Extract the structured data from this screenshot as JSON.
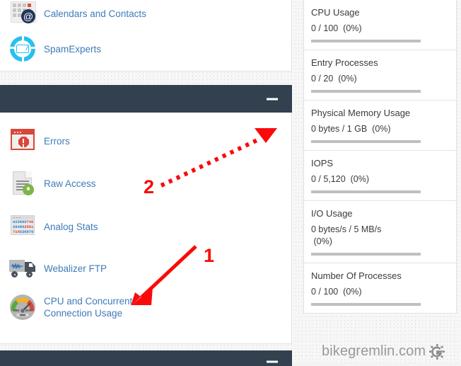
{
  "left_panel": {
    "top_section": {
      "items": [
        {
          "label": "Calendars and Contacts",
          "icon": "calendar-at-icon"
        },
        {
          "label": "SpamExperts",
          "icon": "spam-envelope-icon"
        }
      ]
    },
    "metrics_section_header": {
      "title": "",
      "minimize_label": "–"
    },
    "middle_section": {
      "items": [
        {
          "label": "Errors",
          "icon": "error-browser-icon"
        },
        {
          "label": "Raw Access",
          "icon": "document-download-icon"
        },
        {
          "label": "Analog Stats",
          "icon": "analog-digits-icon"
        },
        {
          "label": "Webalizer FTP",
          "icon": "truck-waveform-icon"
        },
        {
          "label": "CPU and Concurrent Connection Usage",
          "icon": "gauge-icon"
        }
      ]
    },
    "bottom_bar": {
      "minimize_label": "–"
    }
  },
  "analog_icon_digits": {
    "row1_a": "023689",
    "row1_b": "746",
    "row2_a": "26480",
    "row2_b": "2561",
    "row3_a": "714",
    "row3_b": "536870"
  },
  "gauge_icon": {
    "min_label": "MIN",
    "max_label": "MAX"
  },
  "stats_panel": {
    "metrics": [
      {
        "name": "CPU Usage",
        "value": "0 / 100  (0%)",
        "percent": 0
      },
      {
        "name": "Entry Processes",
        "value": "0 / 20  (0%)",
        "percent": 0
      },
      {
        "name": "Physical Memory Usage",
        "value": "0 bytes / 1 GB  (0%)",
        "percent": 0
      },
      {
        "name": "IOPS",
        "value": "0 / 5,120  (0%)",
        "percent": 0
      },
      {
        "name": "I/O Usage",
        "value": "0 bytes/s / 5 MB/s\n (0%)",
        "percent": 0
      },
      {
        "name": "Number Of Processes",
        "value": "0 / 100  (0%)",
        "percent": 0
      }
    ]
  },
  "annotations": [
    {
      "id": "1",
      "label": "1",
      "style": "solid-arrow",
      "color": "#fa0a0a"
    },
    {
      "id": "2",
      "label": "2",
      "style": "dotted-arrow",
      "color": "#fa0a0a"
    }
  ],
  "watermark": {
    "text": "bikegremlin.com",
    "logo": "gremlin-gear-g-logo",
    "color": "#999999"
  },
  "colors": {
    "link": "#3e7bb8",
    "header_bar": "#33404f",
    "annotation_red": "#fa0a0a",
    "bar_track": "#bfbfbf",
    "panel_bg": "#ffffff"
  }
}
